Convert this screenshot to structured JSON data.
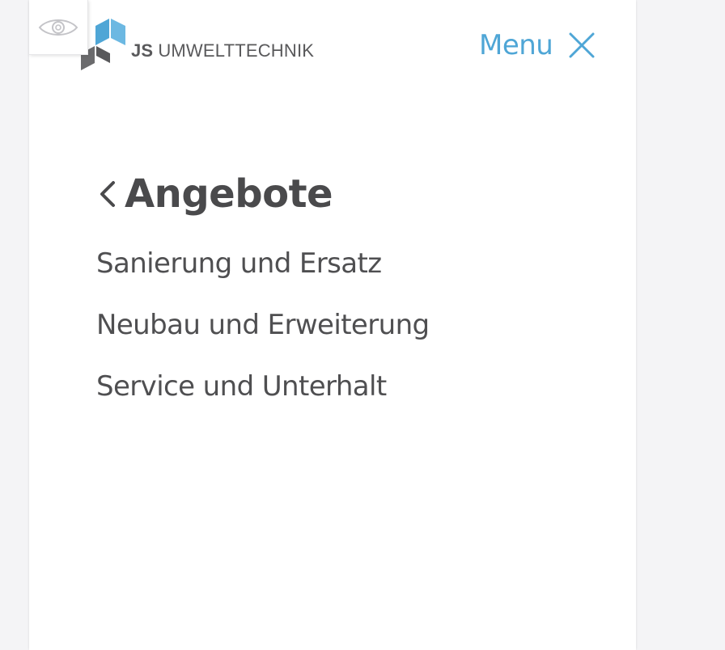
{
  "brand": {
    "logo_bold": "JS",
    "logo_text": "UMWELTTECHNIK",
    "logo_icon": "cube-logo-icon"
  },
  "header": {
    "menu_label": "Menu",
    "close_icon": "close-icon",
    "eye_icon": "eye-icon"
  },
  "nav": {
    "section_title": "Angebote",
    "back_icon": "chevron-left-icon",
    "items": [
      {
        "label": "Sanierung und Ersatz"
      },
      {
        "label": "Neubau und Erweiterung"
      },
      {
        "label": "Service und Unterhalt"
      }
    ]
  },
  "colors": {
    "accent": "#4fa6d6",
    "text_dark": "#4a4a4c",
    "logo_gray": "#59595b",
    "background": "#f4f4f6",
    "panel": "#ffffff"
  }
}
